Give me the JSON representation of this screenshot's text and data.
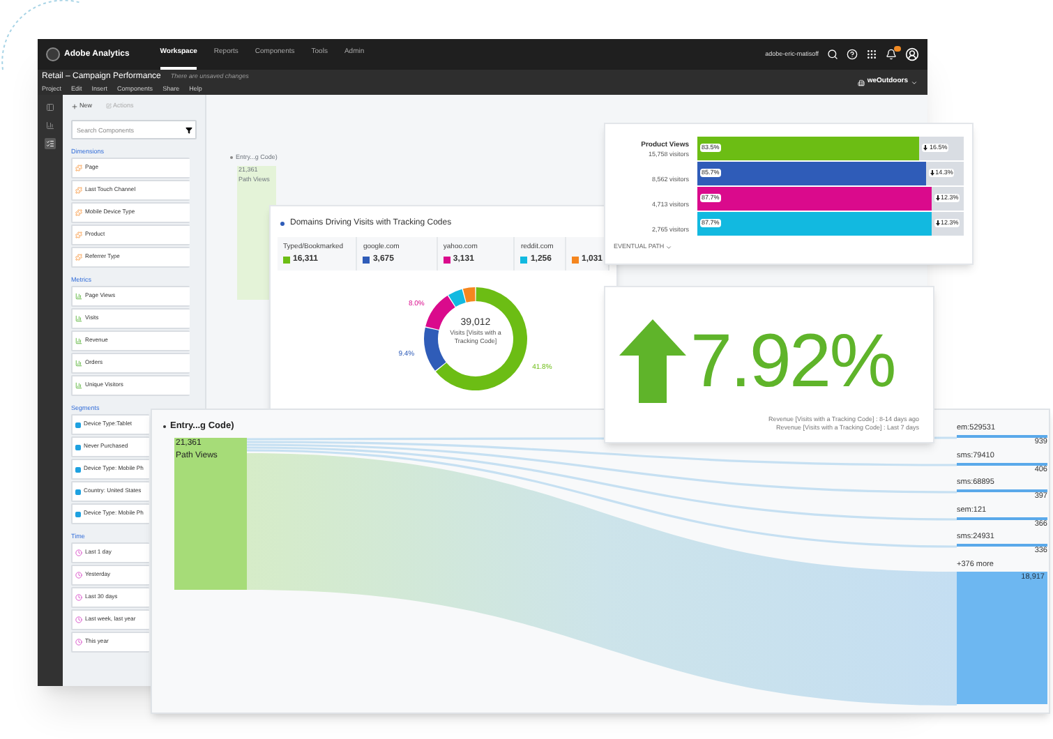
{
  "app_bar": {
    "product": "Adobe Analytics",
    "nav": [
      {
        "label": "Workspace",
        "selected": true
      },
      {
        "label": "Reports",
        "selected": false
      },
      {
        "label": "Components",
        "selected": false
      },
      {
        "label": "Tools",
        "selected": false
      },
      {
        "label": "Admin",
        "selected": false
      }
    ],
    "user": "adobe-eric-matisoff",
    "notifications": true
  },
  "project_bar": {
    "title": "Retail – Campaign Performance",
    "status": "There are unsaved changes",
    "menu": [
      "Project",
      "Edit",
      "Insert",
      "Components",
      "Share",
      "Help"
    ],
    "company": "weOutdoors"
  },
  "rail": [
    {
      "kind": "panels",
      "selected": false
    },
    {
      "kind": "visualizations",
      "selected": false
    },
    {
      "kind": "components",
      "selected": true
    }
  ],
  "panel": {
    "actions": [
      {
        "label": "New",
        "kind": "new",
        "disabled": false
      },
      {
        "label": "Actions",
        "kind": "actions",
        "disabled": true
      }
    ],
    "search": {
      "placeholder": "Search Components"
    },
    "sections": [
      {
        "title": "Dimensions",
        "kind": "dimension",
        "items": [
          "Page",
          "Last Touch Channel",
          "Mobile Device Type",
          "Product",
          "Referrer Type"
        ]
      },
      {
        "title": "Metrics",
        "kind": "metric",
        "items": [
          "Page Views",
          "Visits",
          "Revenue",
          "Orders",
          "Unique Visitors"
        ]
      },
      {
        "title": "Segments",
        "kind": "segment",
        "items": [
          "Device Type:Tablet",
          "Never Purchased",
          "Device Type: Mobile Ph",
          "Country: United States",
          "Device Type: Mobile Ph"
        ]
      },
      {
        "title": "Time",
        "kind": "time",
        "items": [
          "Last 1 day",
          "Yesterday",
          "Last 30 days",
          "Last week, last year",
          "This year"
        ]
      }
    ]
  },
  "background_panel": {
    "title": "Entry...g Code)",
    "value": "21,361",
    "label": "Path Views"
  },
  "product_views": {
    "title": "Product Views",
    "rows": [
      {
        "visitors": "15,758 visitors",
        "level": 0.835,
        "percent": "83.5%",
        "dropoff": "16.5%",
        "color": "#6cbd14"
      },
      {
        "visitors": "8,562 visitors",
        "level": 0.857,
        "percent": "85.7%",
        "dropoff": "14.3%",
        "color": "#2f5cb8"
      },
      {
        "visitors": "4,713 visitors",
        "level": 0.877,
        "percent": "87.7%",
        "dropoff": "12.3%",
        "color": "#da0a8c"
      },
      {
        "visitors": "2,765 visitors",
        "level": 0.877,
        "percent": "87.7%",
        "dropoff": "12.3%",
        "color": "#12b9e0"
      }
    ],
    "footer": "EVENTUAL PATH"
  },
  "donut_card": {
    "title": "Domains Driving Visits with Tracking Codes",
    "legend": [
      {
        "label": "Typed/Bookmarked",
        "value": "16,311",
        "color": "#6cbd14"
      },
      {
        "label": "google.com",
        "value": "3,675",
        "color": "#2f5cb8"
      },
      {
        "label": "yahoo.com",
        "value": "3,131",
        "color": "#da0a8c"
      },
      {
        "label": "reddit.com",
        "value": "1,256",
        "color": "#12b9e0"
      },
      {
        "value": "1,031",
        "color": "#f5861f"
      }
    ],
    "total": "39,012",
    "total_label": "Visits [Visits with a Tracking Code]",
    "chart_data": {
      "type": "donut",
      "series": [
        {
          "values": [
            64.2,
            14.5,
            12.3,
            4.9,
            4.1
          ]
        }
      ],
      "value_labels": [
        "41.8%",
        "9.4%",
        "8.0%",
        null,
        null
      ]
    }
  },
  "metric_card": {
    "value": "7.92%",
    "up": true,
    "notes": [
      "Revenue [Visits with a Tracking Code] : 8-14 days ago",
      "Revenue [Visits with a Tracking Code] : Last 7 days"
    ]
  },
  "flow": {
    "entry": {
      "title": "Entry...g Code)",
      "value": "21,361",
      "label": "Path Views"
    },
    "exits": [
      {
        "label": "em:529531",
        "count": "939",
        "kind": "path"
      },
      {
        "label": "sms:79410",
        "count": "406",
        "kind": "path"
      },
      {
        "label": "sms:68895",
        "count": "397",
        "kind": "path"
      },
      {
        "label": "sem:121",
        "count": "366",
        "kind": "path"
      },
      {
        "label": "sms:24931",
        "count": "336",
        "kind": "path"
      },
      {
        "label": "+376 more",
        "count": "18,917",
        "kind": "more"
      }
    ]
  }
}
